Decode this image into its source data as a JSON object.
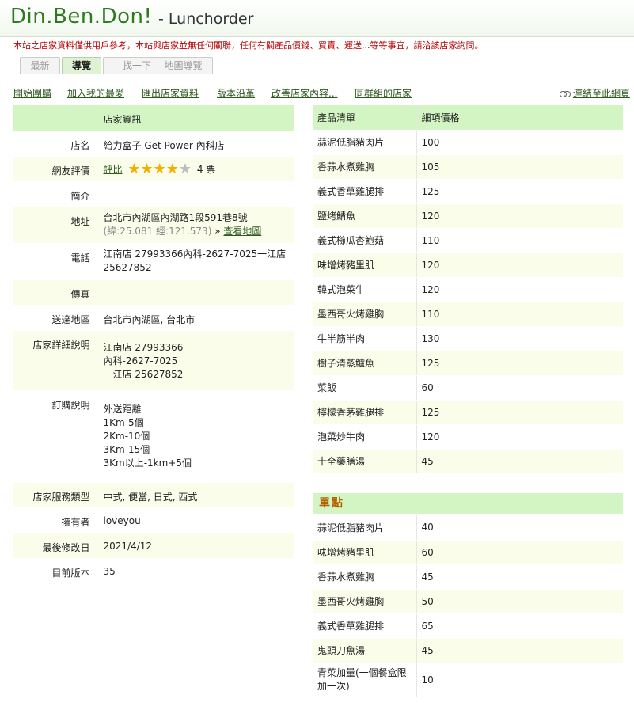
{
  "header": {
    "logo": "Din.Ben.Don!",
    "subtitle": "- Lunchorder"
  },
  "notice": "本站之店家資料僅供用戶參考，本站與店家並無任何關聯，任何有關產品價錢、買賣、運送...等等事宜，請洽該店家詢問。",
  "tabs": [
    {
      "label": "最新"
    },
    {
      "label": "導覽"
    },
    {
      "label": "找一下"
    },
    {
      "label": "地圖導覽"
    }
  ],
  "actions": [
    {
      "label": "開始團購"
    },
    {
      "label": "加入我的最愛"
    },
    {
      "label": "匯出店家資料"
    },
    {
      "label": "版本沿革"
    },
    {
      "label": "改善店家內容..."
    },
    {
      "label": "同群組的店家"
    }
  ],
  "link_web": "連結至此網頁",
  "store": {
    "header": "店家資訊",
    "name_label": "店名",
    "name": "給力盒子 Get Power 內科店",
    "rating_label": "網友評價",
    "rating_link": "評比",
    "rating_value": 4,
    "rating_max": 5,
    "rating_votes": "4 票",
    "intro_label": "簡介",
    "intro": "",
    "address_label": "地址",
    "address": "台北市內湖區內湖路1段591巷8號",
    "coords": "(緯:25.081 經:121.573)",
    "coords_sep": "»",
    "map_link": "查看地圖",
    "phone_label": "電話",
    "phone": "江南店 27993366內科-2627-7025一江店 25627852",
    "fax_label": "傳真",
    "fax": "",
    "delivery_label": "送達地區",
    "delivery": "台北市內湖區, 台北市",
    "detail_label": "店家詳細說明",
    "detail_lines": [
      "江南店 27993366",
      "內科-2627-7025",
      "一江店 25627852"
    ],
    "order_label": "訂購說明",
    "order_lines": [
      "外送距離",
      "1Km-5個",
      "2Km-10個",
      "3Km-15個",
      "3Km以上-1km+5個"
    ],
    "service_label": "店家服務類型",
    "service": "中式, 便當, 日式, 西式",
    "owner_label": "擁有者",
    "owner": "loveyou",
    "modified_label": "最後修改日",
    "modified": "2021/4/12",
    "version_label": "目前版本",
    "version": "35"
  },
  "products": {
    "col_name": "產品清單",
    "col_price": "細項價格",
    "items": [
      {
        "name": "蒜泥低脂豬肉片",
        "price": "100"
      },
      {
        "name": "香蒜水煮雞胸",
        "price": "105"
      },
      {
        "name": "義式香草雞腿排",
        "price": "125"
      },
      {
        "name": "鹽烤鯖魚",
        "price": "120"
      },
      {
        "name": "義式櫛瓜杏鮑菇",
        "price": "110"
      },
      {
        "name": "味增烤豬里肌",
        "price": "120"
      },
      {
        "name": "韓式泡菜牛",
        "price": "120"
      },
      {
        "name": "墨西哥火烤雞胸",
        "price": "110"
      },
      {
        "name": "牛半筋半肉",
        "price": "130"
      },
      {
        "name": "樹子清蒸鱸魚",
        "price": "125"
      },
      {
        "name": "菜飯",
        "price": "60"
      },
      {
        "name": "檸檬香茅雞腿排",
        "price": "125"
      },
      {
        "name": "泡菜炒牛肉",
        "price": "120"
      },
      {
        "name": "十全藥膳湯",
        "price": "45"
      }
    ]
  },
  "singles": {
    "title": "單點",
    "items": [
      {
        "name": "蒜泥低脂豬肉片",
        "price": "40"
      },
      {
        "name": "味增烤豬里肌",
        "price": "60"
      },
      {
        "name": "香蒜水煮雞胸",
        "price": "45"
      },
      {
        "name": "墨西哥火烤雞胸",
        "price": "50"
      },
      {
        "name": "義式香草雞腿排",
        "price": "65"
      },
      {
        "name": "鬼頭刀魚湯",
        "price": "45"
      },
      {
        "name": "青菜加量(一個餐盒限加一次)",
        "price": "10"
      }
    ]
  }
}
